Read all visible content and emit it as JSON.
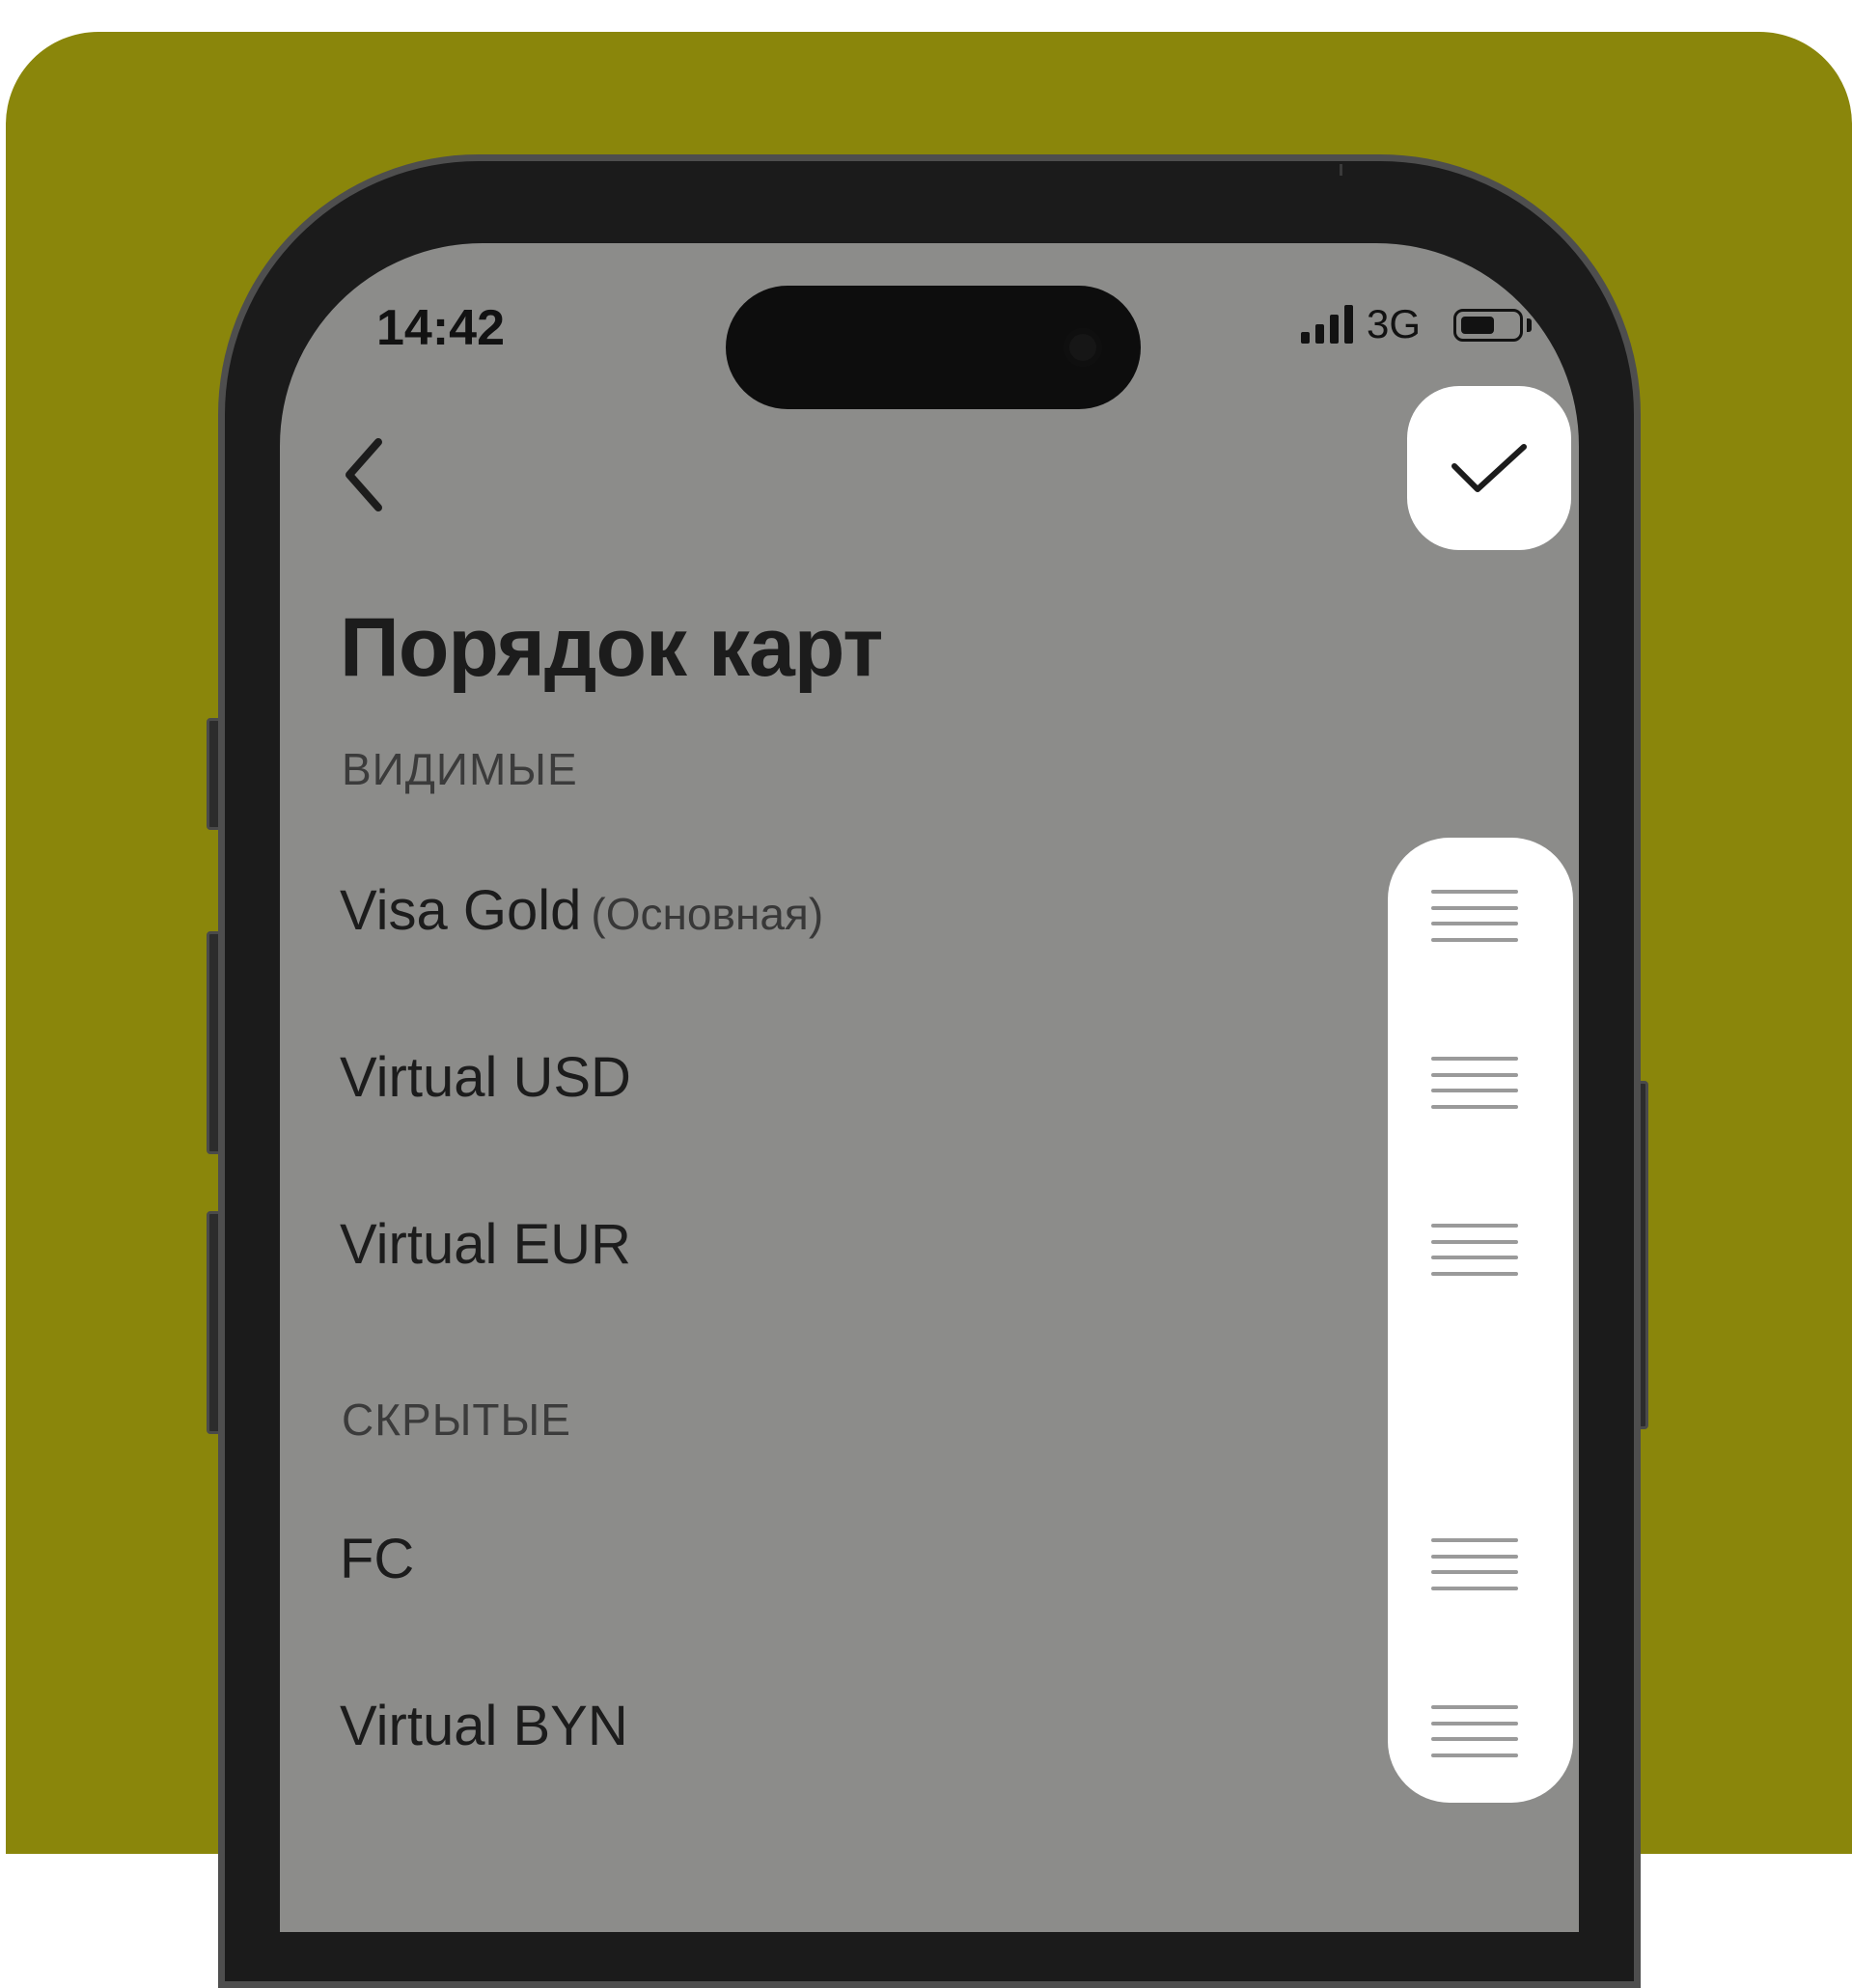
{
  "status_bar": {
    "time": "14:42",
    "network": "3G",
    "battery_level": 0.6
  },
  "nav": {
    "back_icon": "chevron-left-icon",
    "confirm_icon": "checkmark-icon"
  },
  "page": {
    "title": "Порядок карт"
  },
  "sections": {
    "visible": {
      "label": "ВИДИМЫЕ",
      "items": [
        {
          "name": "Visa Gold",
          "badge": "(Основная)"
        },
        {
          "name": "Virtual USD"
        },
        {
          "name": "Virtual EUR"
        }
      ]
    },
    "hidden": {
      "label": "СКРЫТЫЕ",
      "items": [
        {
          "name": "FC"
        },
        {
          "name": "Virtual BYN"
        }
      ]
    }
  },
  "colors": {
    "backdrop": "#8a860b",
    "screen_overlay": "#8c8c8a",
    "highlight": "#ffffff"
  }
}
